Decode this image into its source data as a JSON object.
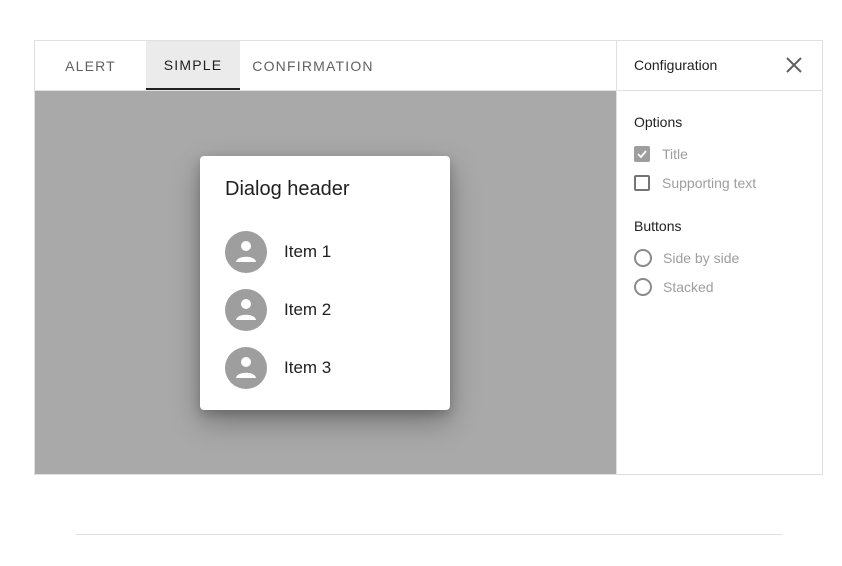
{
  "tabs": [
    {
      "label": "ALERT",
      "selected": false
    },
    {
      "label": "SIMPLE",
      "selected": true
    },
    {
      "label": "CONFIRMATION",
      "selected": false
    }
  ],
  "dialog": {
    "title": "Dialog header",
    "items": [
      {
        "label": "Item 1",
        "icon": "person-avatar-icon"
      },
      {
        "label": "Item 2",
        "icon": "person-avatar-icon"
      },
      {
        "label": "Item 3",
        "icon": "person-avatar-icon"
      }
    ]
  },
  "config": {
    "title": "Configuration",
    "close_icon": "close-icon",
    "options_label": "Options",
    "options": [
      {
        "label": "Title",
        "checked": true
      },
      {
        "label": "Supporting text",
        "checked": false
      }
    ],
    "buttons_label": "Buttons",
    "buttons": [
      {
        "label": "Side by side",
        "selected": false
      },
      {
        "label": "Stacked",
        "selected": false
      }
    ]
  },
  "colors": {
    "scrim": "#a9a9a9",
    "selected_tab_bg": "#ebebeb",
    "avatar": "#9e9e9e",
    "disabled_text": "#9e9e9e"
  }
}
